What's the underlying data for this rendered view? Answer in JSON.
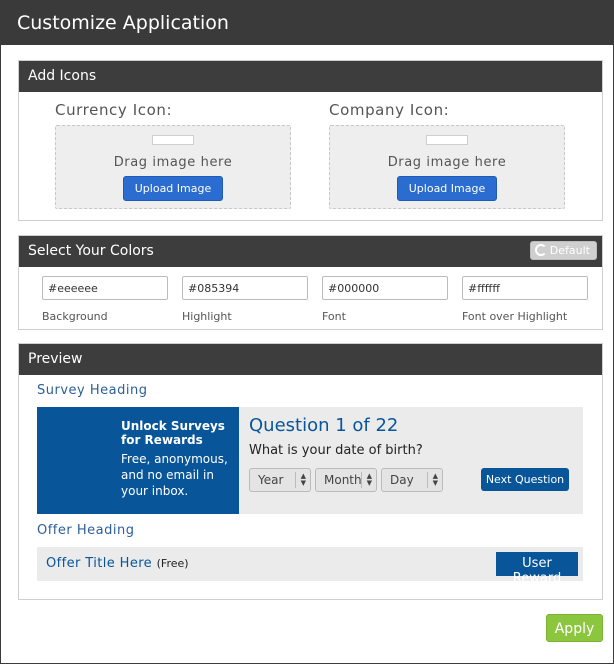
{
  "dialog": {
    "title": "Customize Application"
  },
  "add_icons": {
    "heading": "Add Icons",
    "currency": {
      "label": "Currency Icon:",
      "drag_text": "Drag image here",
      "upload_label": "Upload Image"
    },
    "company": {
      "label": "Company Icon:",
      "drag_text": "Drag image here",
      "upload_label": "Upload Image"
    }
  },
  "colors": {
    "heading": "Select Your Colors",
    "default_label": "Default",
    "fields": [
      {
        "value": "#eeeeee",
        "label": "Background"
      },
      {
        "value": "#085394",
        "label": "Highlight"
      },
      {
        "value": "#000000",
        "label": "Font"
      },
      {
        "value": "#ffffff",
        "label": "Font over Highlight"
      }
    ]
  },
  "preview": {
    "heading": "Preview",
    "survey_heading": "Survey Heading",
    "unlock_title": "Unlock Surveys for Rewards",
    "unlock_text": "Free, anonymous, and no email in your inbox.",
    "question": "Question 1 of 22",
    "question_text": "What is your date of birth?",
    "selects": {
      "year": "Year",
      "month": "Month",
      "day": "Day"
    },
    "next_label": "Next Question",
    "offer_heading": "Offer Heading",
    "offer_title": "Offer Title Here",
    "offer_free": "(Free)",
    "reward_label": "User Reward"
  },
  "footer": {
    "apply_label": "Apply"
  },
  "theme": {
    "highlight": "#085394",
    "header": "#3a3a3a",
    "apply": "#8cc63f",
    "upload": "#2a6ccf"
  }
}
